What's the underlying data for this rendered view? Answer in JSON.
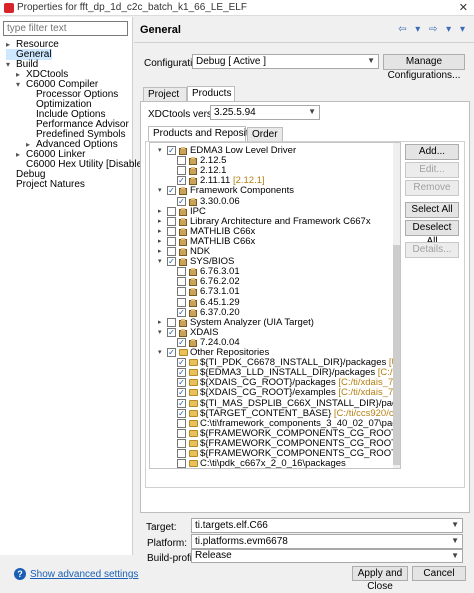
{
  "window": {
    "title": "Properties for fft_dp_1d_c2c_batch_k1_66_LE_ELF"
  },
  "filter": {
    "placeholder": "type filter text"
  },
  "left_tree": [
    {
      "label": "Resource",
      "level": 0,
      "twisty": "▸"
    },
    {
      "label": "General",
      "level": 0,
      "twisty": "",
      "selected": true
    },
    {
      "label": "Build",
      "level": 0,
      "twisty": "▾"
    },
    {
      "label": "XDCtools",
      "level": 1,
      "twisty": "▸"
    },
    {
      "label": "C6000 Compiler",
      "level": 1,
      "twisty": "▾"
    },
    {
      "label": "Processor Options",
      "level": 2,
      "twisty": ""
    },
    {
      "label": "Optimization",
      "level": 2,
      "twisty": ""
    },
    {
      "label": "Include Options",
      "level": 2,
      "twisty": ""
    },
    {
      "label": "Performance Advisor",
      "level": 2,
      "twisty": ""
    },
    {
      "label": "Predefined Symbols",
      "level": 2,
      "twisty": ""
    },
    {
      "label": "Advanced Options",
      "level": 2,
      "twisty": "▸"
    },
    {
      "label": "C6000 Linker",
      "level": 1,
      "twisty": "▸"
    },
    {
      "label": "C6000 Hex Utility  [Disabled]",
      "level": 1,
      "twisty": ""
    },
    {
      "label": "Debug",
      "level": 0,
      "twisty": ""
    },
    {
      "label": "Project Natures",
      "level": 0,
      "twisty": ""
    }
  ],
  "header": {
    "title": "General",
    "nav": "⇦ ▾ ⇨ ▾ ▾"
  },
  "configuration": {
    "label": "Configuration:",
    "value": "Debug  [ Active ]",
    "manage_button": "Manage Configurations..."
  },
  "tabs": [
    {
      "label": "Project"
    },
    {
      "label": "Products"
    }
  ],
  "xdctools": {
    "label": "XDCtools version:",
    "value": "3.25.5.94"
  },
  "subtabs": [
    {
      "label": "Products and Repositories"
    },
    {
      "label": "Order"
    }
  ],
  "product_rows": [
    {
      "text": "EDMA3 Low Level Driver",
      "annotation": "",
      "indent": 0,
      "twisty": "▾",
      "check": "✓",
      "icon": "pkg"
    },
    {
      "text": "2.12.5",
      "annotation": "",
      "indent": 1,
      "twisty": "",
      "check": "",
      "icon": "pkg"
    },
    {
      "text": "2.12.1",
      "annotation": "",
      "indent": 1,
      "twisty": "",
      "check": "",
      "icon": "pkg"
    },
    {
      "text": "2.11.11",
      "annotation": "[2.12.1]",
      "indent": 1,
      "twisty": "",
      "check": "✓",
      "icon": "pkg"
    },
    {
      "text": "Framework Components",
      "annotation": "",
      "indent": 0,
      "twisty": "▾",
      "check": "✓",
      "icon": "pkg"
    },
    {
      "text": "3.30.0.06",
      "annotation": "",
      "indent": 1,
      "twisty": "",
      "check": "✓",
      "icon": "pkg"
    },
    {
      "text": "IPC",
      "annotation": "",
      "indent": 0,
      "twisty": "▸",
      "check": "",
      "icon": "pkg"
    },
    {
      "text": "Library Architecture and Framework C667x",
      "annotation": "",
      "indent": 0,
      "twisty": "▸",
      "check": "",
      "icon": "pkg"
    },
    {
      "text": "MATHLIB C66x",
      "annotation": "",
      "indent": 0,
      "twisty": "▸",
      "check": "",
      "icon": "pkg"
    },
    {
      "text": "MATHLIB C66x",
      "annotation": "",
      "indent": 0,
      "twisty": "▸",
      "check": "",
      "icon": "pkg"
    },
    {
      "text": "NDK",
      "annotation": "",
      "indent": 0,
      "twisty": "▸",
      "check": "",
      "icon": "pkg"
    },
    {
      "text": "SYS/BIOS",
      "annotation": "",
      "indent": 0,
      "twisty": "▾",
      "check": "✓",
      "icon": "pkg"
    },
    {
      "text": "6.76.3.01",
      "annotation": "",
      "indent": 1,
      "twisty": "",
      "check": "",
      "icon": "pkg"
    },
    {
      "text": "6.76.2.02",
      "annotation": "",
      "indent": 1,
      "twisty": "",
      "check": "",
      "icon": "pkg"
    },
    {
      "text": "6.73.1.01",
      "annotation": "",
      "indent": 1,
      "twisty": "",
      "check": "",
      "icon": "pkg"
    },
    {
      "text": "6.45.1.29",
      "annotation": "",
      "indent": 1,
      "twisty": "",
      "check": "",
      "icon": "pkg"
    },
    {
      "text": "6.37.0.20",
      "annotation": "",
      "indent": 1,
      "twisty": "",
      "check": "✓",
      "icon": "pkg"
    },
    {
      "text": "System Analyzer (UIA Target)",
      "annotation": "",
      "indent": 0,
      "twisty": "▸",
      "check": "",
      "icon": "pkg"
    },
    {
      "text": "XDAIS",
      "annotation": "",
      "indent": 0,
      "twisty": "▾",
      "check": "✓",
      "icon": "pkg"
    },
    {
      "text": "7.24.0.04",
      "annotation": "",
      "indent": 1,
      "twisty": "",
      "check": "✓",
      "icon": "pkg"
    },
    {
      "text": "Other Repositories",
      "annotation": "",
      "indent": 0,
      "twisty": "▾",
      "check": "✓",
      "icon": "folder"
    },
    {
      "text": "${TI_PDK_C6678_INSTALL_DIR}/packages",
      "annotation": "[Unresolved]",
      "indent": 1,
      "twisty": "",
      "check": "✓",
      "icon": "folder"
    },
    {
      "text": "${EDMA3_LLD_INSTALL_DIR}/packages",
      "annotation": "[C:/ti/edma3_lld_2_12_01_",
      "indent": 1,
      "twisty": "",
      "check": "✓",
      "icon": "folder"
    },
    {
      "text": "${XDAIS_CG_ROOT}/packages",
      "annotation": "[C:/ti/xdais_7_24_00_04/packages]",
      "indent": 1,
      "twisty": "",
      "check": "✓",
      "icon": "folder"
    },
    {
      "text": "${XDAIS_CG_ROOT}/examples",
      "annotation": "[C:/ti/xdais_7_24_00_04/examples]",
      "indent": 1,
      "twisty": "",
      "check": "✓",
      "icon": "folder"
    },
    {
      "text": "${TI_MAS_DSPLIB_C66X_INSTALL_DIR}/packages",
      "annotation": "[C:/ti/dsplib_c66x_3",
      "indent": 1,
      "twisty": "",
      "check": "✓",
      "icon": "folder"
    },
    {
      "text": "${TARGET_CONTENT_BASE}",
      "annotation": "[C:/ti/ccs920/ccs/ccs_base]",
      "indent": 1,
      "twisty": "",
      "check": "✓",
      "icon": "folder"
    },
    {
      "text": "C:\\ti\\framework_components_3_40_02_07\\packages",
      "annotation": "",
      "indent": 1,
      "twisty": "",
      "check": "",
      "icon": "folder"
    },
    {
      "text": "${FRAMEWORK_COMPONENTS_CG_ROOT}/examples",
      "annotation": "[C:/ti/framew",
      "indent": 1,
      "twisty": "",
      "check": "",
      "icon": "folder"
    },
    {
      "text": "${FRAMEWORK_COMPONENTS_CG_ROOT}/fctools/packages",
      "annotation": "[C:/ti/fra",
      "indent": 1,
      "twisty": "",
      "check": "",
      "icon": "folder"
    },
    {
      "text": "${FRAMEWORK_COMPONENTS_CG_ROOT}/packages",
      "annotation": "[C:/ti/framew",
      "indent": 1,
      "twisty": "",
      "check": "",
      "icon": "folder"
    },
    {
      "text": "C:\\ti\\pdk_c667x_2_0_16\\packages",
      "annotation": "",
      "indent": 1,
      "twisty": "",
      "check": "",
      "icon": "folder"
    }
  ],
  "side_buttons": [
    {
      "label": "Add...",
      "enabled": true
    },
    {
      "label": "Edit...",
      "enabled": false
    },
    {
      "label": "Remove",
      "enabled": false
    },
    {
      "label": "Select All",
      "enabled": true
    },
    {
      "label": "Deselect All",
      "enabled": true
    },
    {
      "label": "Details...",
      "enabled": false
    }
  ],
  "target": {
    "label": "Target:",
    "value": "ti.targets.elf.C66"
  },
  "platform": {
    "label": "Platform:",
    "value": "ti.platforms.evm6678"
  },
  "build_profile": {
    "label": "Build-profile:",
    "value": "Release"
  },
  "footer": {
    "advanced_link": "Show advanced settings",
    "apply_close": "Apply and Close",
    "cancel": "Cancel"
  }
}
